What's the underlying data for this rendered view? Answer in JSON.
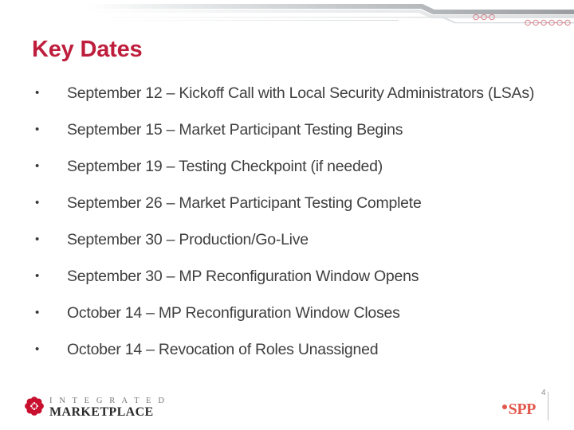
{
  "slide": {
    "title": "Key Dates",
    "title_color": "#BE1E3C",
    "body_text_color": "#3f3f3f",
    "background_color": "#ffffff"
  },
  "header_decoration": {
    "name": "header-swoosh-graphic",
    "bar_gray_dark": "#9a9da1",
    "bar_gray_light": "#e3e5e7",
    "accent_circle_color": "#d98a92",
    "upper_circle_count": 3,
    "lower_circle_count": 6
  },
  "bullets": {
    "marker_glyph": "•",
    "items": [
      {
        "text": "September 12 – Kickoff Call with Local Security Administrators (LSAs)"
      },
      {
        "text": "September 15 – Market Participant Testing Begins"
      },
      {
        "text": "September 19 – Testing Checkpoint (if needed)"
      },
      {
        "text": "September 26 – Market Participant Testing Complete"
      },
      {
        "text": "September 30 – Production/Go-Live"
      },
      {
        "text": "September 30 – MP Reconfiguration Window Opens"
      },
      {
        "text": "October 14 – MP Reconfiguration Window Closes"
      },
      {
        "text": "October 14 – Revocation of Roles Unassigned"
      }
    ]
  },
  "footer": {
    "integrated_marketplace_logo": {
      "line1": "I N T E G R A T E D",
      "line2": "MARKETPLACE",
      "mark_color": "#C8102E"
    },
    "spp_logo": {
      "word": "SPP",
      "color": "#E2574C"
    },
    "page_number": "4"
  }
}
